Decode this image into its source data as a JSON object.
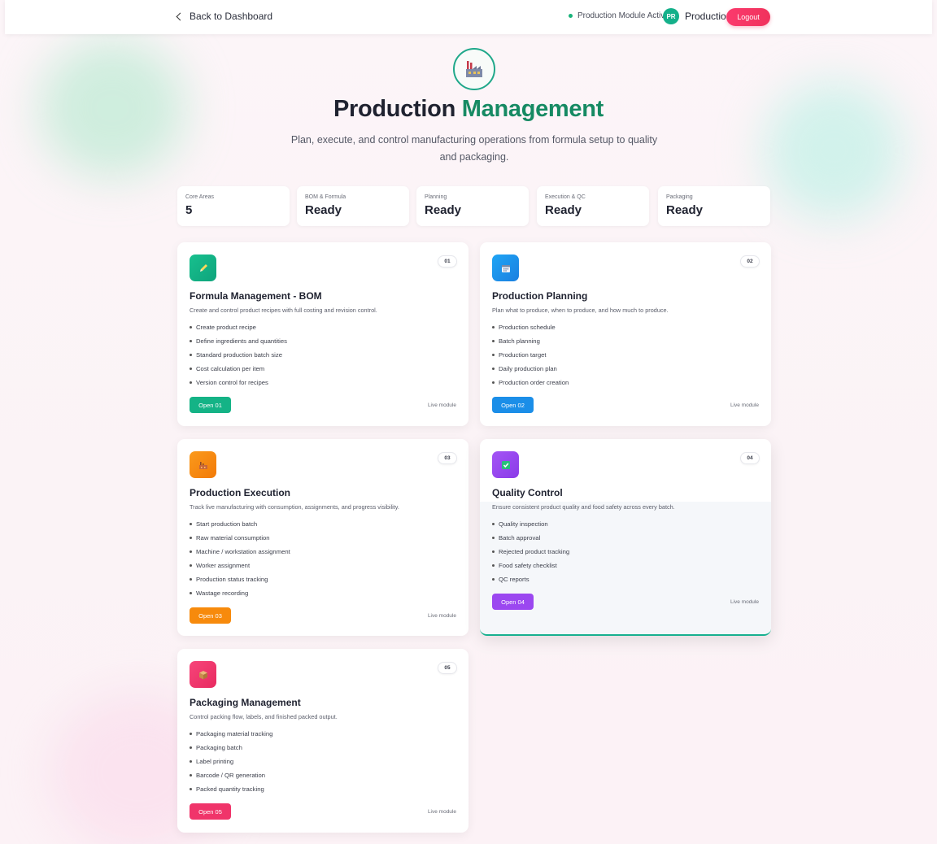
{
  "header": {
    "back_label": "Back to Dashboard",
    "status_text": "Production Module Active",
    "avatar_initials": "PR",
    "user_label": "Production",
    "logout_label": "Logout"
  },
  "hero": {
    "title_main": "Production",
    "title_accent": "Management",
    "subtitle": "Plan, execute, and control manufacturing operations from formula setup to quality and packaging."
  },
  "stats": [
    {
      "label": "Core Areas",
      "value": "5"
    },
    {
      "label": "BOM & Formula",
      "value": "Ready"
    },
    {
      "label": "Planning",
      "value": "Ready"
    },
    {
      "label": "Execution & QC",
      "value": "Ready"
    },
    {
      "label": "Packaging",
      "value": "Ready"
    }
  ],
  "cards": [
    {
      "num": "01",
      "title": "Formula Management - BOM",
      "description": "Create and control product recipes with full costing and revision control.",
      "items": [
        "Create product recipe",
        "Define ingredients and quantities",
        "Standard production batch size",
        "Cost calculation per item",
        "Version control for recipes"
      ],
      "button": "Open 01",
      "status": "Live module",
      "icon": "pencil-icon",
      "color": "#14b386"
    },
    {
      "num": "02",
      "title": "Production Planning",
      "description": "Plan what to produce, when to produce, and how much to produce.",
      "items": [
        "Production schedule",
        "Batch planning",
        "Production target",
        "Daily production plan",
        "Production order creation"
      ],
      "button": "Open 02",
      "status": "Live module",
      "icon": "calendar-icon",
      "color": "#1b8ee8"
    },
    {
      "num": "03",
      "title": "Production Execution",
      "description": "Track live manufacturing with consumption, assignments, and progress visibility.",
      "items": [
        "Start production batch",
        "Raw material consumption",
        "Machine / workstation assignment",
        "Worker assignment",
        "Production status tracking",
        "Wastage recording"
      ],
      "button": "Open 03",
      "status": "Live module",
      "icon": "factory-icon",
      "color": "#f78a0c"
    },
    {
      "num": "04",
      "title": "Quality Control",
      "description": "Ensure consistent product quality and food safety across every batch.",
      "items": [
        "Quality inspection",
        "Batch approval",
        "Rejected product tracking",
        "Food safety checklist",
        "QC reports"
      ],
      "button": "Open 04",
      "status": "Live module",
      "icon": "checkbox-icon",
      "color": "#9b47f0"
    },
    {
      "num": "05",
      "title": "Packaging Management",
      "description": "Control packing flow, labels, and finished packed output.",
      "items": [
        "Packaging material tracking",
        "Packaging batch",
        "Label printing",
        "Barcode / QR generation",
        "Packed quantity tracking"
      ],
      "button": "Open 05",
      "status": "Live module",
      "icon": "package-icon",
      "color": "#f0346a"
    }
  ]
}
